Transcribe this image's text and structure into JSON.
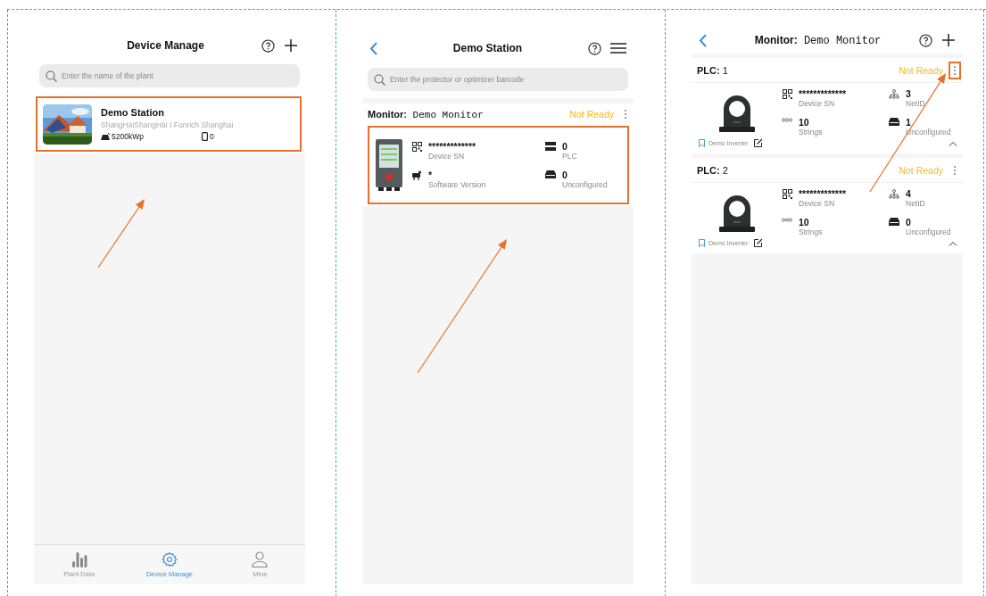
{
  "device_manage": {
    "title": "Device Manage",
    "search": {
      "placeholder": "Enter the name of the plant"
    },
    "plants": [
      {
        "name": "Demo Station",
        "location": "ShangHaiShangHai I Fonrich Shanghai",
        "capacity": "5200kWp",
        "devices": "0",
        "highlighted": true
      }
    ],
    "tabs": [
      {
        "label": "Plant Data",
        "kind": "chart",
        "selected": false
      },
      {
        "label": "Device Manage",
        "kind": "gear",
        "selected": true
      },
      {
        "label": "Mine",
        "kind": "person",
        "selected": false
      }
    ]
  },
  "station": {
    "title": "Demo Station",
    "search": {
      "placeholder": "Enter the protector or optimizer barcode"
    },
    "monitors": [
      {
        "label": "Monitor:",
        "name": "Demo Monitor",
        "status": "Not Ready",
        "highlighted": true,
        "stats": [
          {
            "kind": "sn",
            "value": "*************",
            "label": "Device SN"
          },
          {
            "kind": "plc",
            "value": "0",
            "label": "PLC"
          },
          {
            "kind": "software",
            "value": "*",
            "label": "Software Version"
          },
          {
            "kind": "unconfigured",
            "value": "0",
            "label": "Unconfigured"
          }
        ]
      }
    ]
  },
  "monitor": {
    "title_label": "Monitor:",
    "title_name": "Demo Monitor",
    "plcs": [
      {
        "label": "PLC:",
        "number": "1",
        "status": "Not Ready",
        "menu_highlighted": true,
        "inverter": "Demo Inverter",
        "stats": [
          {
            "kind": "sn",
            "value": "*************",
            "label": "Device SN"
          },
          {
            "kind": "netid",
            "value": "3",
            "label": "NetID"
          },
          {
            "kind": "strings",
            "value": "10",
            "label": "Strings"
          },
          {
            "kind": "unconfigured",
            "value": "1",
            "label": "Unconfigured"
          }
        ]
      },
      {
        "label": "PLC:",
        "number": "2",
        "status": "Not Ready",
        "menu_highlighted": false,
        "inverter": "Demo Inverter",
        "stats": [
          {
            "kind": "sn",
            "value": "*************",
            "label": "Device SN"
          },
          {
            "kind": "netid",
            "value": "4",
            "label": "NetID"
          },
          {
            "kind": "strings",
            "value": "10",
            "label": "Strings"
          },
          {
            "kind": "unconfigured",
            "value": "0",
            "label": "Unconfigured"
          }
        ]
      }
    ]
  }
}
